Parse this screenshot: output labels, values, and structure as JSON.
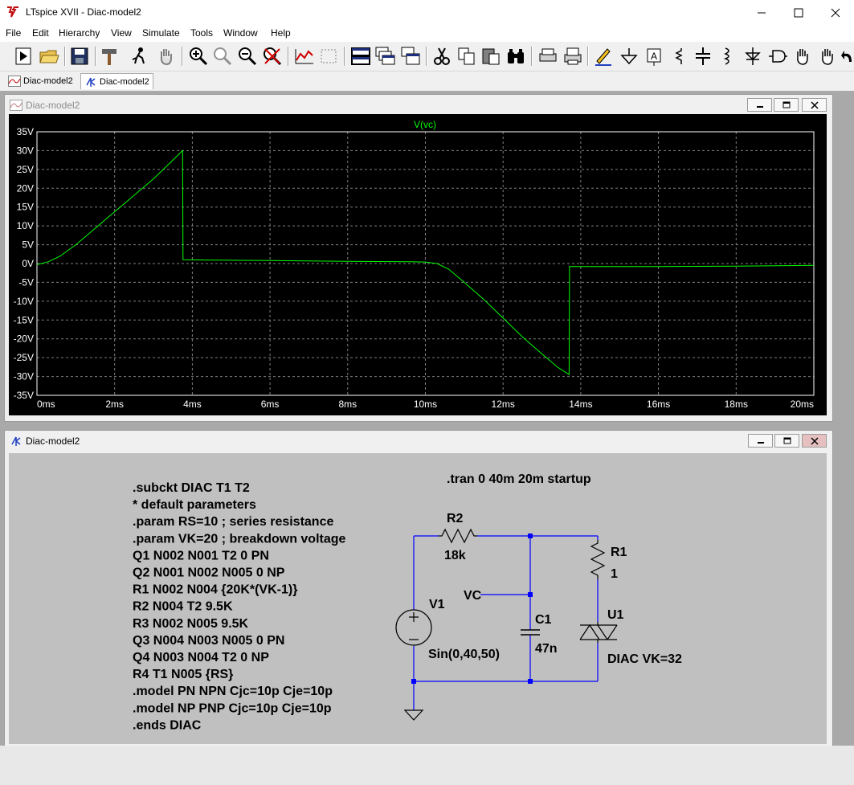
{
  "app": {
    "title": "LTspice XVII - Diac-model2"
  },
  "menu": [
    "File",
    "Edit",
    "Hierarchy",
    "View",
    "Simulate",
    "Tools",
    "Window",
    "Help"
  ],
  "tabs": [
    {
      "label": "Diac-model2",
      "icon": "waveform-icon",
      "active": false
    },
    {
      "label": "Diac-model2",
      "icon": "schematic-icon",
      "active": true
    }
  ],
  "plot_window": {
    "title": "Diac-model2"
  },
  "schematic_window": {
    "title": "Diac-model2"
  },
  "chart_data": {
    "type": "line",
    "title": "V(vc)",
    "series": [
      {
        "name": "V(vc)",
        "color": "#00ff00",
        "x": [
          0,
          0.3,
          0.6,
          1,
          1.4,
          1.8,
          2.2,
          2.6,
          3,
          3.3,
          3.6,
          3.75,
          3.76,
          4.5,
          6,
          8,
          9.5,
          10,
          10.3,
          10.6,
          11,
          11.5,
          12,
          12.5,
          13,
          13.4,
          13.7,
          13.71,
          14,
          16,
          18,
          20
        ],
        "y": [
          -0.3,
          0.5,
          2,
          5,
          8.5,
          12,
          15.5,
          19,
          22.5,
          25.5,
          28.5,
          30,
          1,
          0.9,
          0.8,
          0.6,
          0.5,
          0.4,
          0,
          -1.5,
          -5,
          -9.5,
          -14.5,
          -19.5,
          -24,
          -27.5,
          -29.5,
          -0.8,
          -0.8,
          -0.8,
          -0.7,
          -0.5
        ]
      }
    ],
    "x_ticks": [
      "0ms",
      "2ms",
      "4ms",
      "6ms",
      "8ms",
      "10ms",
      "12ms",
      "14ms",
      "16ms",
      "18ms",
      "20ms"
    ],
    "y_ticks": [
      "35V",
      "30V",
      "25V",
      "20V",
      "15V",
      "10V",
      "5V",
      "0V",
      "-5V",
      "-10V",
      "-15V",
      "-20V",
      "-25V",
      "-30V",
      "-35V"
    ],
    "xlim": [
      0,
      20
    ],
    "ylim": [
      -35,
      35
    ],
    "grid": true
  },
  "netlist": {
    "lines": [
      ".subckt DIAC T1 T2",
      "* default parameters",
      ".param RS=10 ; series resistance",
      ".param VK=20 ; breakdown voltage",
      "Q1 N002 N001 T2 0 PN",
      "Q2 N001 N002 N005 0 NP",
      "R1 N002 N004 {20K*(VK-1)}",
      "R2 N004 T2 9.5K",
      "R3 N002 N005 9.5K",
      "Q3 N004 N003 N005 0 PN",
      "Q4 N003 N004 T2 0 NP",
      "R4 T1 N005 {RS}",
      ".model PN NPN Cjc=10p Cje=10p",
      ".model NP PNP Cjc=10p Cje=10p",
      ".ends DIAC"
    ]
  },
  "schematic": {
    "directive": ".tran 0 40m 20m startup",
    "r2_name": "R2",
    "r2_value": "18k",
    "r1_name": "R1",
    "r1_value": "1",
    "v1_name": "V1",
    "v1_value": "Sin(0,40,50)",
    "c1_name": "C1",
    "c1_value": "47n",
    "net_label": "VC",
    "u1_name": "U1",
    "u1_value": "DIAC VK=32"
  }
}
